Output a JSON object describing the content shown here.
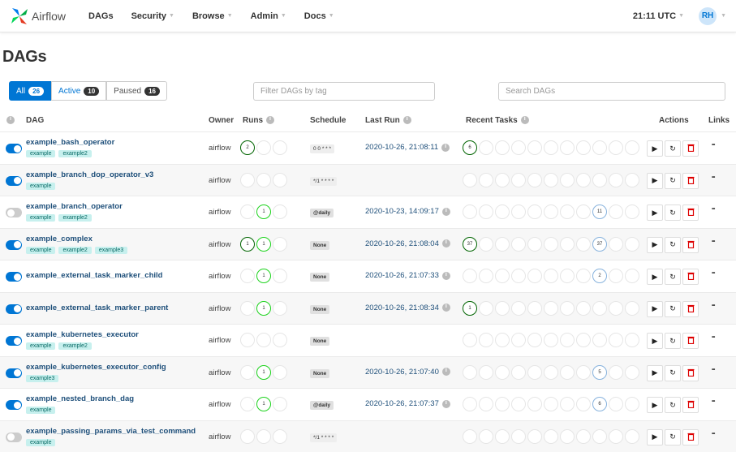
{
  "nav": {
    "brand": "Airflow",
    "items": [
      "DAGs",
      "Security",
      "Browse",
      "Admin",
      "Docs"
    ],
    "clock": "21:11 UTC",
    "avatar": "RH"
  },
  "page_title": "DAGs",
  "filters": {
    "all_label": "All",
    "all_count": "26",
    "active_label": "Active",
    "active_count": "10",
    "paused_label": "Paused",
    "paused_count": "16",
    "tag_placeholder": "Filter DAGs by tag",
    "search_placeholder": "Search DAGs"
  },
  "columns": {
    "dag": "DAG",
    "owner": "Owner",
    "runs": "Runs",
    "schedule": "Schedule",
    "last_run": "Last Run",
    "recent_tasks": "Recent Tasks",
    "actions": "Actions",
    "links": "Links"
  },
  "colors": {
    "primary": "#0076d4",
    "success": "#1ed31e",
    "tag_bg": "#c7f0ee"
  },
  "dags": [
    {
      "name": "example_bash_operator",
      "tags": [
        "example",
        "example2"
      ],
      "on": true,
      "owner": "airflow",
      "runs": {
        "dg": "2"
      },
      "schedule": "0 0 * * *",
      "sched_thin": true,
      "last_run": "2020-10-26, 21:08:11",
      "tasks": {
        "0": {
          "c": "dg",
          "v": "6"
        }
      }
    },
    {
      "name": "example_branch_dop_operator_v3",
      "tags": [
        "example"
      ],
      "on": true,
      "owner": "airflow",
      "runs": {},
      "schedule": "*/1 * * * *",
      "sched_thin": true,
      "last_run": "",
      "tasks": {}
    },
    {
      "name": "example_branch_operator",
      "tags": [
        "example",
        "example2"
      ],
      "on": false,
      "owner": "airflow",
      "runs": {
        "g": "1"
      },
      "schedule": "@daily",
      "sched_thin": false,
      "last_run": "2020-10-23, 14:09:17",
      "tasks": {
        "8": {
          "c": "lb",
          "v": "11"
        }
      }
    },
    {
      "name": "example_complex",
      "tags": [
        "example",
        "example2",
        "example3"
      ],
      "on": true,
      "owner": "airflow",
      "runs": {
        "dg": "1",
        "g": "1"
      },
      "schedule": "None",
      "sched_thin": false,
      "last_run": "2020-10-26, 21:08:04",
      "tasks": {
        "0": {
          "c": "dg",
          "v": "37"
        },
        "8": {
          "c": "lb",
          "v": "37"
        }
      }
    },
    {
      "name": "example_external_task_marker_child",
      "tags": [],
      "on": true,
      "owner": "airflow",
      "runs": {
        "g": "1"
      },
      "schedule": "None",
      "sched_thin": false,
      "last_run": "2020-10-26, 21:07:33",
      "tasks": {
        "8": {
          "c": "lb",
          "v": "2"
        }
      }
    },
    {
      "name": "example_external_task_marker_parent",
      "tags": [],
      "on": true,
      "owner": "airflow",
      "runs": {
        "g": "1"
      },
      "schedule": "None",
      "sched_thin": false,
      "last_run": "2020-10-26, 21:08:34",
      "tasks": {
        "0": {
          "c": "dg",
          "v": "1"
        }
      }
    },
    {
      "name": "example_kubernetes_executor",
      "tags": [
        "example",
        "example2"
      ],
      "on": true,
      "owner": "airflow",
      "runs": {},
      "schedule": "None",
      "sched_thin": false,
      "last_run": "",
      "tasks": {}
    },
    {
      "name": "example_kubernetes_executor_config",
      "tags": [
        "example3"
      ],
      "on": true,
      "owner": "airflow",
      "runs": {
        "g": "1"
      },
      "schedule": "None",
      "sched_thin": false,
      "last_run": "2020-10-26, 21:07:40",
      "tasks": {
        "8": {
          "c": "lb",
          "v": "5"
        }
      }
    },
    {
      "name": "example_nested_branch_dag",
      "tags": [
        "example"
      ],
      "on": true,
      "owner": "airflow",
      "runs": {
        "g": "1"
      },
      "schedule": "@daily",
      "sched_thin": false,
      "last_run": "2020-10-26, 21:07:37",
      "tasks": {
        "8": {
          "c": "lb",
          "v": "6"
        }
      }
    },
    {
      "name": "example_passing_params_via_test_command",
      "tags": [
        "example"
      ],
      "on": false,
      "owner": "airflow",
      "runs": {},
      "schedule": "*/1 * * * *",
      "sched_thin": true,
      "last_run": "",
      "tasks": {}
    }
  ]
}
